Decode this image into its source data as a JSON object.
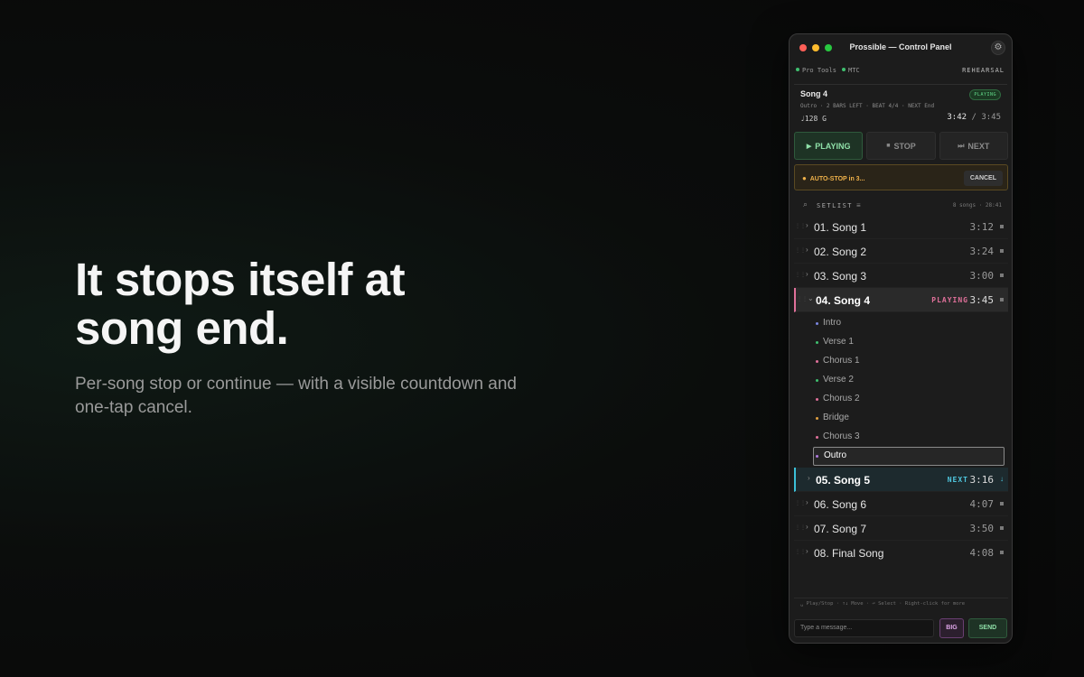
{
  "hero": {
    "headline_line1": "It stops itself at",
    "headline_line2": "song end.",
    "subtitle_line1": "Per-song stop or continue — with a visible countdown and",
    "subtitle_line2": "one-tap cancel."
  },
  "window": {
    "title": "Prossible — Control Panel",
    "gear_icon": "⚙"
  },
  "status": {
    "source1": "Pro Tools",
    "source2": "MTC",
    "mode": "REHEARSAL",
    "dot_color": "#3fbf6f"
  },
  "now_playing": {
    "song": "Song 4",
    "state_badge": "PLAYING",
    "meta": "Outro · 2 BARS LEFT · BEAT 4/4 · NEXT End",
    "bpm_key": "♩128  G",
    "elapsed": "3:42",
    "separator": "/",
    "total": "3:45"
  },
  "controls": {
    "play_icon": "▶",
    "play_label": "PLAYING",
    "stop_icon": "■",
    "stop_label": "STOP",
    "next_icon": "⏭",
    "next_label": "NEXT"
  },
  "autostop": {
    "label": "AUTO-STOP in 3...",
    "cancel_label": "CANCEL",
    "accent": "#f0b24a"
  },
  "setlist": {
    "search_icon": "⌕",
    "title": "SETLIST",
    "filter_icon": "≡",
    "count": "8 songs · 28:41",
    "songs": [
      {
        "name": "01. Song 1",
        "duration": "3:12"
      },
      {
        "name": "02. Song 2",
        "duration": "3:24"
      },
      {
        "name": "03. Song 3",
        "duration": "3:00"
      },
      {
        "name": "04. Song 4",
        "duration": "3:45",
        "tag": "PLAYING"
      },
      {
        "name": "05. Song 5",
        "duration": "3:16",
        "tag": "NEXT"
      },
      {
        "name": "06. Song 6",
        "duration": "4:07"
      },
      {
        "name": "07. Song 7",
        "duration": "3:50"
      },
      {
        "name": "08. Final Song",
        "duration": "4:08"
      }
    ],
    "sections": [
      {
        "label": "Intro",
        "color": "#7a86e0"
      },
      {
        "label": "Verse 1",
        "color": "#3fbf6f"
      },
      {
        "label": "Chorus 1",
        "color": "#e0709a"
      },
      {
        "label": "Verse 2",
        "color": "#3fbf6f"
      },
      {
        "label": "Chorus 2",
        "color": "#e0709a"
      },
      {
        "label": "Bridge",
        "color": "#e0a040"
      },
      {
        "label": "Chorus 3",
        "color": "#e0709a"
      },
      {
        "label": "Outro",
        "color": "#b07ae0"
      }
    ]
  },
  "hint": "␣ Play/Stop · ↑↓ Move · ⏎ Select · Right-click for more",
  "composer": {
    "placeholder": "Type a message...",
    "big_label": "BIG",
    "send_label": "SEND"
  }
}
